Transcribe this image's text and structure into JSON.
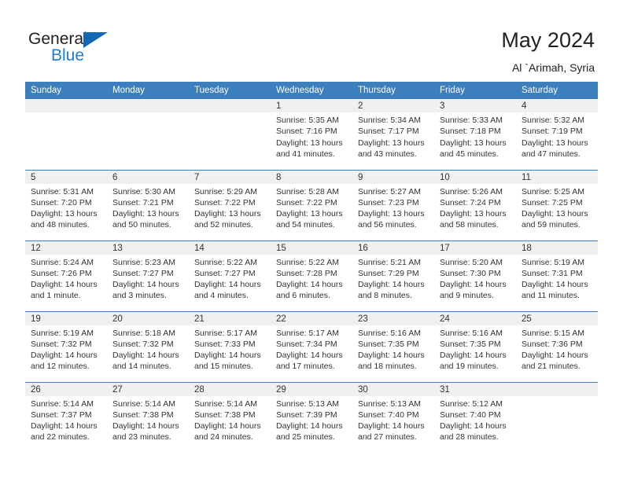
{
  "brand": {
    "name_part1": "General",
    "name_part2": "Blue",
    "triangle_color": "#1268b3",
    "blue_color": "#1b7fd4"
  },
  "header": {
    "title": "May 2024",
    "subtitle": "Al `Arimah, Syria"
  },
  "theme": {
    "header_blue": "#3d7ebd",
    "daynum_strip": "#f0f0f0",
    "text": "#333333"
  },
  "calendar": {
    "weekday_headers": [
      "Sunday",
      "Monday",
      "Tuesday",
      "Wednesday",
      "Thursday",
      "Friday",
      "Saturday"
    ],
    "weeks": [
      [
        {
          "day": "",
          "sunrise": "",
          "sunset": "",
          "daylight_line1": "",
          "daylight_line2": ""
        },
        {
          "day": "",
          "sunrise": "",
          "sunset": "",
          "daylight_line1": "",
          "daylight_line2": ""
        },
        {
          "day": "",
          "sunrise": "",
          "sunset": "",
          "daylight_line1": "",
          "daylight_line2": ""
        },
        {
          "day": "1",
          "sunrise": "Sunrise: 5:35 AM",
          "sunset": "Sunset: 7:16 PM",
          "daylight_line1": "Daylight: 13 hours",
          "daylight_line2": "and 41 minutes."
        },
        {
          "day": "2",
          "sunrise": "Sunrise: 5:34 AM",
          "sunset": "Sunset: 7:17 PM",
          "daylight_line1": "Daylight: 13 hours",
          "daylight_line2": "and 43 minutes."
        },
        {
          "day": "3",
          "sunrise": "Sunrise: 5:33 AM",
          "sunset": "Sunset: 7:18 PM",
          "daylight_line1": "Daylight: 13 hours",
          "daylight_line2": "and 45 minutes."
        },
        {
          "day": "4",
          "sunrise": "Sunrise: 5:32 AM",
          "sunset": "Sunset: 7:19 PM",
          "daylight_line1": "Daylight: 13 hours",
          "daylight_line2": "and 47 minutes."
        }
      ],
      [
        {
          "day": "5",
          "sunrise": "Sunrise: 5:31 AM",
          "sunset": "Sunset: 7:20 PM",
          "daylight_line1": "Daylight: 13 hours",
          "daylight_line2": "and 48 minutes."
        },
        {
          "day": "6",
          "sunrise": "Sunrise: 5:30 AM",
          "sunset": "Sunset: 7:21 PM",
          "daylight_line1": "Daylight: 13 hours",
          "daylight_line2": "and 50 minutes."
        },
        {
          "day": "7",
          "sunrise": "Sunrise: 5:29 AM",
          "sunset": "Sunset: 7:22 PM",
          "daylight_line1": "Daylight: 13 hours",
          "daylight_line2": "and 52 minutes."
        },
        {
          "day": "8",
          "sunrise": "Sunrise: 5:28 AM",
          "sunset": "Sunset: 7:22 PM",
          "daylight_line1": "Daylight: 13 hours",
          "daylight_line2": "and 54 minutes."
        },
        {
          "day": "9",
          "sunrise": "Sunrise: 5:27 AM",
          "sunset": "Sunset: 7:23 PM",
          "daylight_line1": "Daylight: 13 hours",
          "daylight_line2": "and 56 minutes."
        },
        {
          "day": "10",
          "sunrise": "Sunrise: 5:26 AM",
          "sunset": "Sunset: 7:24 PM",
          "daylight_line1": "Daylight: 13 hours",
          "daylight_line2": "and 58 minutes."
        },
        {
          "day": "11",
          "sunrise": "Sunrise: 5:25 AM",
          "sunset": "Sunset: 7:25 PM",
          "daylight_line1": "Daylight: 13 hours",
          "daylight_line2": "and 59 minutes."
        }
      ],
      [
        {
          "day": "12",
          "sunrise": "Sunrise: 5:24 AM",
          "sunset": "Sunset: 7:26 PM",
          "daylight_line1": "Daylight: 14 hours",
          "daylight_line2": "and 1 minute."
        },
        {
          "day": "13",
          "sunrise": "Sunrise: 5:23 AM",
          "sunset": "Sunset: 7:27 PM",
          "daylight_line1": "Daylight: 14 hours",
          "daylight_line2": "and 3 minutes."
        },
        {
          "day": "14",
          "sunrise": "Sunrise: 5:22 AM",
          "sunset": "Sunset: 7:27 PM",
          "daylight_line1": "Daylight: 14 hours",
          "daylight_line2": "and 4 minutes."
        },
        {
          "day": "15",
          "sunrise": "Sunrise: 5:22 AM",
          "sunset": "Sunset: 7:28 PM",
          "daylight_line1": "Daylight: 14 hours",
          "daylight_line2": "and 6 minutes."
        },
        {
          "day": "16",
          "sunrise": "Sunrise: 5:21 AM",
          "sunset": "Sunset: 7:29 PM",
          "daylight_line1": "Daylight: 14 hours",
          "daylight_line2": "and 8 minutes."
        },
        {
          "day": "17",
          "sunrise": "Sunrise: 5:20 AM",
          "sunset": "Sunset: 7:30 PM",
          "daylight_line1": "Daylight: 14 hours",
          "daylight_line2": "and 9 minutes."
        },
        {
          "day": "18",
          "sunrise": "Sunrise: 5:19 AM",
          "sunset": "Sunset: 7:31 PM",
          "daylight_line1": "Daylight: 14 hours",
          "daylight_line2": "and 11 minutes."
        }
      ],
      [
        {
          "day": "19",
          "sunrise": "Sunrise: 5:19 AM",
          "sunset": "Sunset: 7:32 PM",
          "daylight_line1": "Daylight: 14 hours",
          "daylight_line2": "and 12 minutes."
        },
        {
          "day": "20",
          "sunrise": "Sunrise: 5:18 AM",
          "sunset": "Sunset: 7:32 PM",
          "daylight_line1": "Daylight: 14 hours",
          "daylight_line2": "and 14 minutes."
        },
        {
          "day": "21",
          "sunrise": "Sunrise: 5:17 AM",
          "sunset": "Sunset: 7:33 PM",
          "daylight_line1": "Daylight: 14 hours",
          "daylight_line2": "and 15 minutes."
        },
        {
          "day": "22",
          "sunrise": "Sunrise: 5:17 AM",
          "sunset": "Sunset: 7:34 PM",
          "daylight_line1": "Daylight: 14 hours",
          "daylight_line2": "and 17 minutes."
        },
        {
          "day": "23",
          "sunrise": "Sunrise: 5:16 AM",
          "sunset": "Sunset: 7:35 PM",
          "daylight_line1": "Daylight: 14 hours",
          "daylight_line2": "and 18 minutes."
        },
        {
          "day": "24",
          "sunrise": "Sunrise: 5:16 AM",
          "sunset": "Sunset: 7:35 PM",
          "daylight_line1": "Daylight: 14 hours",
          "daylight_line2": "and 19 minutes."
        },
        {
          "day": "25",
          "sunrise": "Sunrise: 5:15 AM",
          "sunset": "Sunset: 7:36 PM",
          "daylight_line1": "Daylight: 14 hours",
          "daylight_line2": "and 21 minutes."
        }
      ],
      [
        {
          "day": "26",
          "sunrise": "Sunrise: 5:14 AM",
          "sunset": "Sunset: 7:37 PM",
          "daylight_line1": "Daylight: 14 hours",
          "daylight_line2": "and 22 minutes."
        },
        {
          "day": "27",
          "sunrise": "Sunrise: 5:14 AM",
          "sunset": "Sunset: 7:38 PM",
          "daylight_line1": "Daylight: 14 hours",
          "daylight_line2": "and 23 minutes."
        },
        {
          "day": "28",
          "sunrise": "Sunrise: 5:14 AM",
          "sunset": "Sunset: 7:38 PM",
          "daylight_line1": "Daylight: 14 hours",
          "daylight_line2": "and 24 minutes."
        },
        {
          "day": "29",
          "sunrise": "Sunrise: 5:13 AM",
          "sunset": "Sunset: 7:39 PM",
          "daylight_line1": "Daylight: 14 hours",
          "daylight_line2": "and 25 minutes."
        },
        {
          "day": "30",
          "sunrise": "Sunrise: 5:13 AM",
          "sunset": "Sunset: 7:40 PM",
          "daylight_line1": "Daylight: 14 hours",
          "daylight_line2": "and 27 minutes."
        },
        {
          "day": "31",
          "sunrise": "Sunrise: 5:12 AM",
          "sunset": "Sunset: 7:40 PM",
          "daylight_line1": "Daylight: 14 hours",
          "daylight_line2": "and 28 minutes."
        },
        {
          "day": "",
          "sunrise": "",
          "sunset": "",
          "daylight_line1": "",
          "daylight_line2": ""
        }
      ]
    ]
  }
}
